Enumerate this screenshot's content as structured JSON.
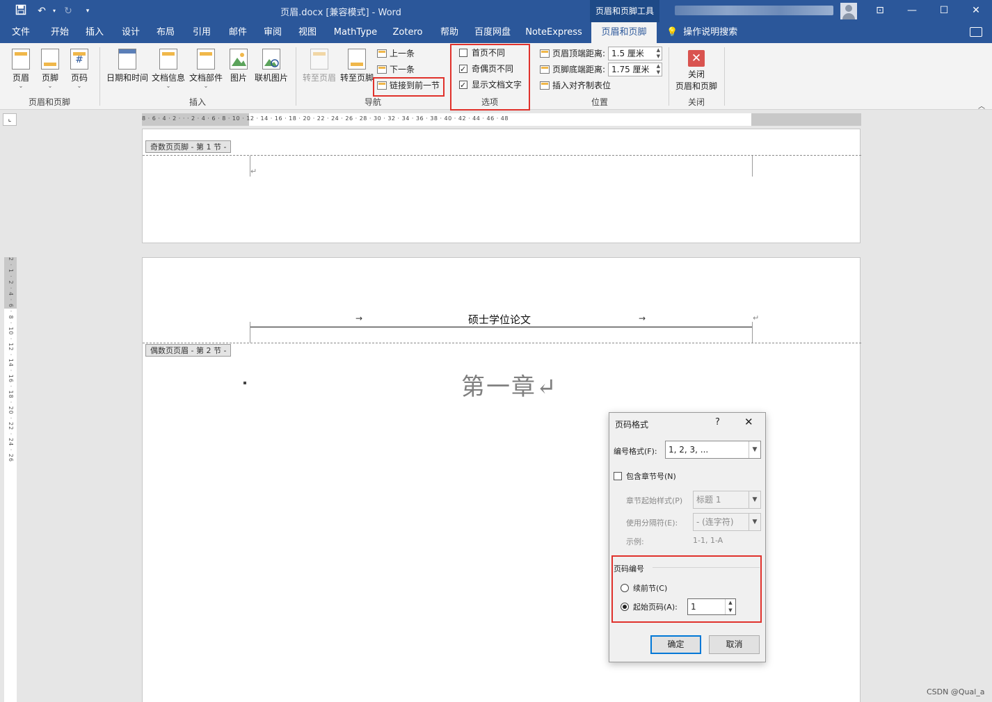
{
  "titlebar": {
    "title": "页眉.docx [兼容模式]  -  Word",
    "context_tab": "页眉和页脚工具",
    "save_icon": "save-icon",
    "undo_icon": "undo-icon",
    "redo_icon": "redo-icon",
    "customize_icon": "customize-qat-icon",
    "ribbon_display_icon": "ribbon-display-icon",
    "minimize_icon": "minimize-icon",
    "maximize_icon": "maximize-icon",
    "close_icon": "close-icon"
  },
  "tabs": [
    "文件",
    "开始",
    "插入",
    "设计",
    "布局",
    "引用",
    "邮件",
    "审阅",
    "视图",
    "MathType",
    "Zotero",
    "帮助",
    "百度网盘",
    "NoteExpress",
    "页眉和页脚"
  ],
  "active_tab": "页眉和页脚",
  "tell_me": "操作说明搜索",
  "ribbon": {
    "hf_group": {
      "label": "页眉和页脚",
      "header": "页眉",
      "footer": "页脚",
      "page_number": "页码"
    },
    "insert_group": {
      "label": "插入",
      "datetime": "日期和时间",
      "docinfo": "文档信息",
      "quickparts": "文档部件",
      "picture": "图片",
      "online_picture": "联机图片"
    },
    "nav_group": {
      "label": "导航",
      "goto_header": "转至页眉",
      "goto_footer": "转至页脚",
      "previous": "上一条",
      "next": "下一条",
      "link_previous": "链接到前一节"
    },
    "options_group": {
      "label": "选项",
      "different_first": "首页不同",
      "different_odd_even": "奇偶页不同",
      "show_doc_text": "显示文档文字"
    },
    "position_group": {
      "label": "位置",
      "header_from_top_label": "页眉顶端距离:",
      "header_from_top": "1.5 厘米",
      "footer_from_bottom_label": "页脚底端距离:",
      "footer_from_bottom": "1.75 厘米",
      "insert_align_tab": "插入对齐制表位"
    },
    "close_group": {
      "label": "关闭",
      "close_line1": "关闭",
      "close_line2": "页眉和页脚"
    }
  },
  "ruler_marks": "8 · 6 · 4 · 2 · · · 2 · 4 · 6 · 8 · 10 · 12 · 14 · 16 · 18 · 20 · 22 · 24 · 26 · 28 · 30 · 32 · 34 · 36 · 38 · 40 · 42 · 44 · 46 · 48",
  "vruler_marks": "2 · 1 · 2 · 4 · 6 · 8 · 10 · 12 · 14 · 16 · 18 · 20 · 22 · 24 · 26",
  "document": {
    "odd_footer_tag": "奇数页页脚 - 第 1 节 -",
    "even_header_tag": "偶数页页眉 - 第 2 节 -",
    "header_text": "硕士学位论文",
    "tab_arrow": "→",
    "para_mark": "↵",
    "chapter_title": "第一章↵"
  },
  "dialog": {
    "title": "页码格式",
    "help": "?",
    "close": "✕",
    "number_format_label": "编号格式(F):",
    "number_format_value": "1, 2, 3, ...",
    "include_chapter": "包含章节号(N)",
    "chapter_style_label": "章节起始样式(P)",
    "chapter_style_value": "标题 1",
    "separator_label": "使用分隔符(E):",
    "separator_value": "-  (连字符)",
    "example_label": "示例:",
    "example_value": "1-1, 1-A",
    "page_numbering_label": "页码编号",
    "continue_label": "续前节(C)",
    "start_at_label": "起始页码(A):",
    "start_at_value": "1",
    "ok": "确定",
    "cancel": "取消"
  },
  "watermark": "CSDN @Qual_a",
  "colors": {
    "ribbon_blue": "#2b579a",
    "highlight_red": "#e0312b"
  }
}
